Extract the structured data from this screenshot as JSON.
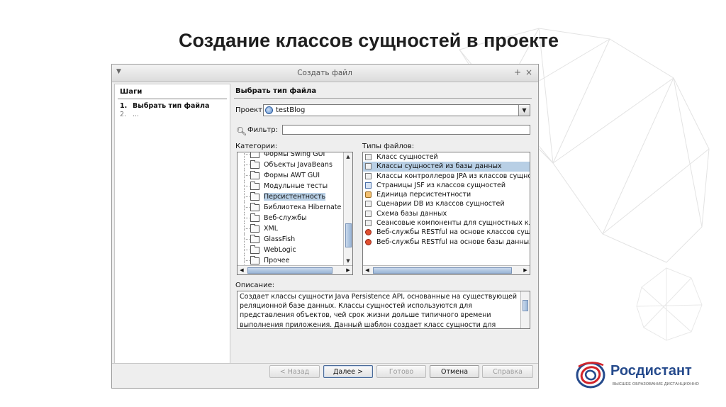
{
  "slide": {
    "title": "Создание классов сущностей в проекте"
  },
  "dialog": {
    "title": "Создать файл",
    "menu_icon": "triangle-down",
    "pin_icon": "pin",
    "close_icon": "close",
    "steps": {
      "header": "Шаги",
      "items": [
        {
          "num": "1.",
          "label": "Выбрать тип файла",
          "current": true
        },
        {
          "num": "2.",
          "label": "...",
          "current": false
        }
      ]
    },
    "panel_title": "Выбрать тип файла",
    "project_label": "Проект:",
    "project_value": "testBlog",
    "filter_label": "Фильтр:",
    "filter_value": "",
    "categories_label": "Категории:",
    "categories": [
      {
        "label": "Формы Swing GUI",
        "selected": false
      },
      {
        "label": "Объекты JavaBeans",
        "selected": false
      },
      {
        "label": "Формы AWT GUI",
        "selected": false
      },
      {
        "label": "Модульные тесты",
        "selected": false
      },
      {
        "label": "Персистентность",
        "selected": true
      },
      {
        "label": "Библиотека Hibernate",
        "selected": false
      },
      {
        "label": "Веб-службы",
        "selected": false
      },
      {
        "label": "XML",
        "selected": false
      },
      {
        "label": "GlassFish",
        "selected": false
      },
      {
        "label": "WebLogic",
        "selected": false
      },
      {
        "label": "Прочее",
        "selected": false
      }
    ],
    "file_types_label": "Типы файлов:",
    "file_types": [
      {
        "label": "Класс сущностей",
        "icon": "class-icon",
        "selected": false
      },
      {
        "label": "Классы сущностей из базы данных",
        "icon": "class-icon",
        "selected": true
      },
      {
        "label": "Классы контроллеров JPA из классов сущно",
        "icon": "class-icon",
        "selected": false
      },
      {
        "label": "Страницы JSF из классов сущностей",
        "icon": "jsf-icon",
        "selected": false
      },
      {
        "label": "Единица персистентности",
        "icon": "persistence-unit-icon",
        "selected": false
      },
      {
        "label": "Сценарии DB из классов сущностей",
        "icon": "class-icon",
        "selected": false
      },
      {
        "label": "Схема базы данных",
        "icon": "schema-icon",
        "selected": false
      },
      {
        "label": "Сеансовые компоненты для сущностных кл",
        "icon": "class-icon",
        "selected": false
      },
      {
        "label": "Веб-службы RESTful на основе классов сущ",
        "icon": "rest-icon",
        "selected": false
      },
      {
        "label": "Веб-службы RESTful на основе базы данных",
        "icon": "rest-icon",
        "selected": false
      }
    ],
    "description_label": "Описание:",
    "description": "Создает классы сущности Java Persistence API, основанные на существующей реляционной базе данных. Классы сущностей используются для представления объектов, чей срок жизни дольше типичного времени выполнения приложения. Данный шаблон создает класс сущности для каждой выбранной таблицы, поддерживающей сущности, именованные запросы",
    "buttons": {
      "back": "< Назад",
      "next": "Далее >",
      "finish": "Готово",
      "cancel": "Отмена",
      "help": "Справка"
    }
  },
  "logo": {
    "name": "Росдистант",
    "tagline": "ВЫСШЕЕ ОБРАЗОВАНИЕ ДИСТАНЦИОННО",
    "colors": {
      "blue": "#254a8c",
      "red": "#d2242a"
    }
  }
}
